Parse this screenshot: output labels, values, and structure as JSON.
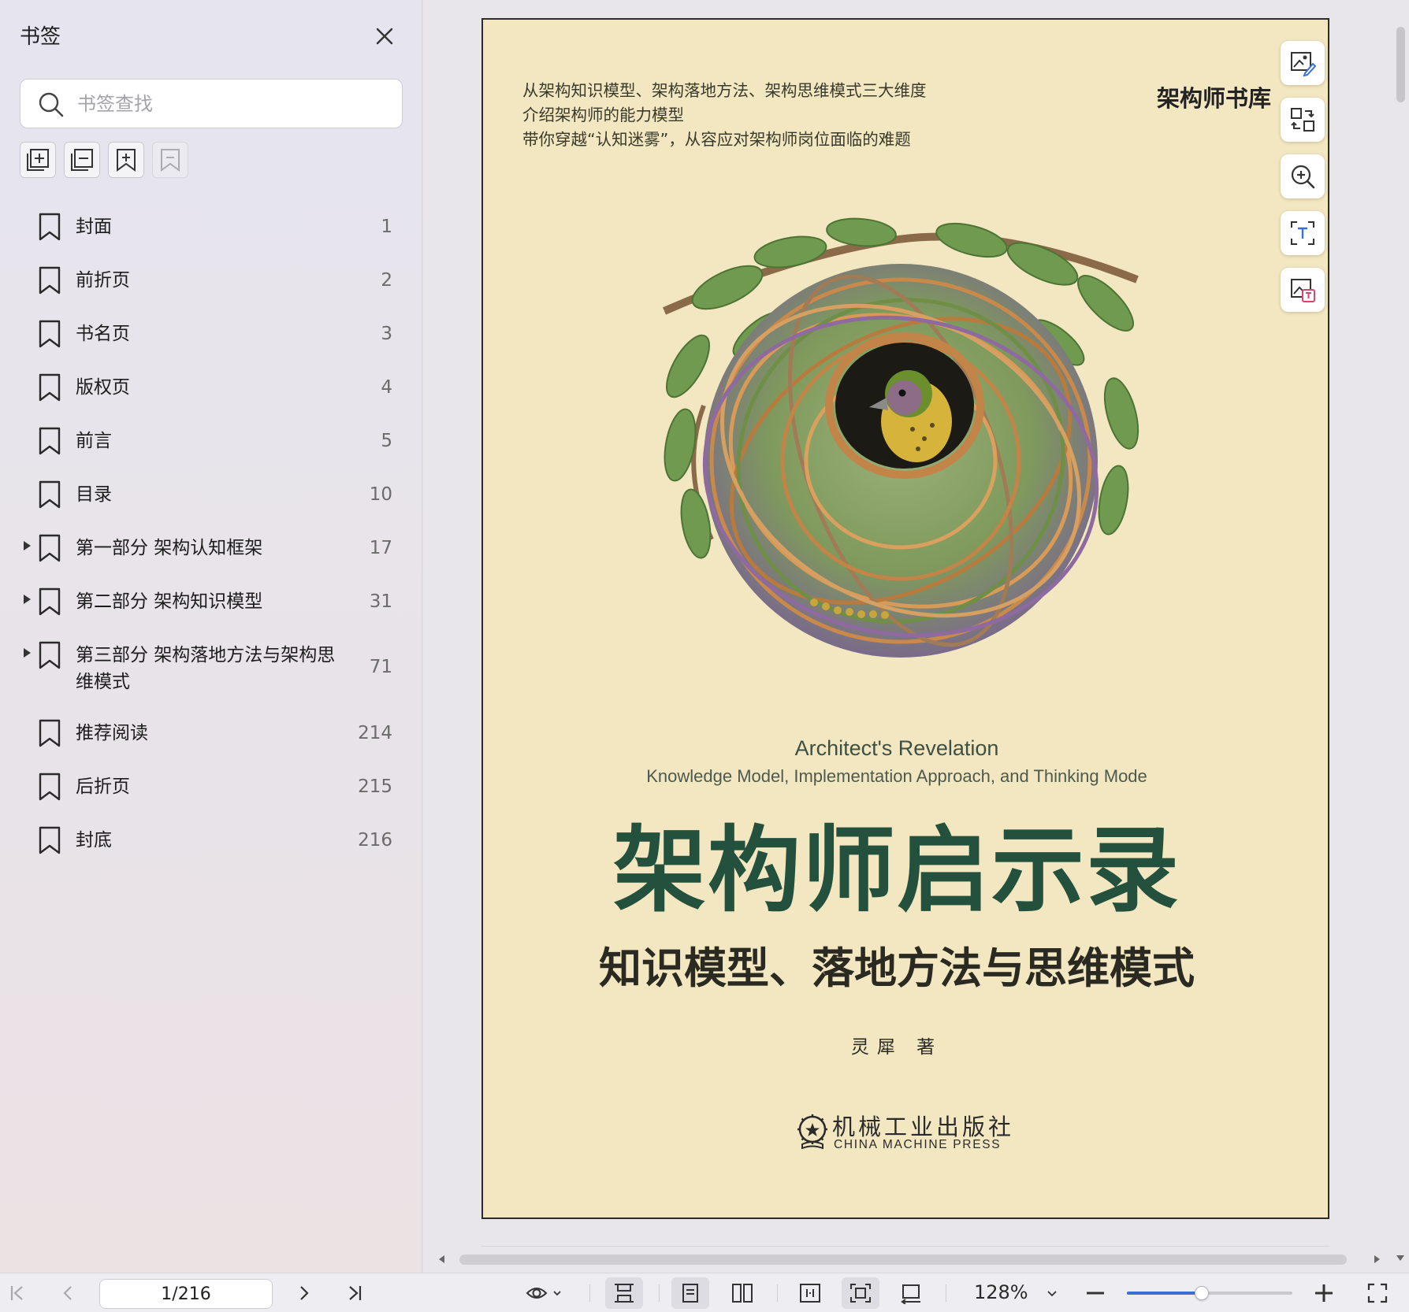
{
  "sidebar": {
    "title": "书签",
    "search_placeholder": "书签查找",
    "bookmarks": [
      {
        "label": "封面",
        "page": "1",
        "expandable": false
      },
      {
        "label": "前折页",
        "page": "2",
        "expandable": false
      },
      {
        "label": "书名页",
        "page": "3",
        "expandable": false
      },
      {
        "label": "版权页",
        "page": "4",
        "expandable": false
      },
      {
        "label": "前言",
        "page": "5",
        "expandable": false
      },
      {
        "label": "目录",
        "page": "10",
        "expandable": false
      },
      {
        "label": "第一部分 架构认知框架",
        "page": "17",
        "expandable": true
      },
      {
        "label": "第二部分 架构知识模型",
        "page": "31",
        "expandable": true
      },
      {
        "label": "第三部分 架构落地方法与架构思维模式",
        "page": "71",
        "expandable": true
      },
      {
        "label": "推荐阅读",
        "page": "214",
        "expandable": false
      },
      {
        "label": "后折页",
        "page": "215",
        "expandable": false
      },
      {
        "label": "封底",
        "page": "216",
        "expandable": false
      }
    ]
  },
  "cover": {
    "tagline": [
      "从架构知识模型、架构落地方法、架构思维模式三大维度",
      "介绍架构师的能力模型",
      "带你穿越“认知迷雾”，从容应对架构师岗位面临的难题"
    ],
    "series": "架构师书库",
    "en_title": "Architect's Revelation",
    "en_subtitle": "Knowledge Model, Implementation Approach, and Thinking Mode",
    "cn_title": "架构师启示录",
    "cn_subtitle": "知识模型、落地方法与思维模式",
    "author": "灵犀 著",
    "publisher_cn": "机械工业出版社",
    "publisher_en": "CHINA MACHINE PRESS"
  },
  "toolbar": {
    "page_indicator": "1/216",
    "zoom_level": "128%",
    "zoom_fraction": 0.45
  },
  "colors": {
    "cover_bg": "#f2e7c0",
    "title_green": "#24503e",
    "accent_blue": "#3b6fd8"
  }
}
